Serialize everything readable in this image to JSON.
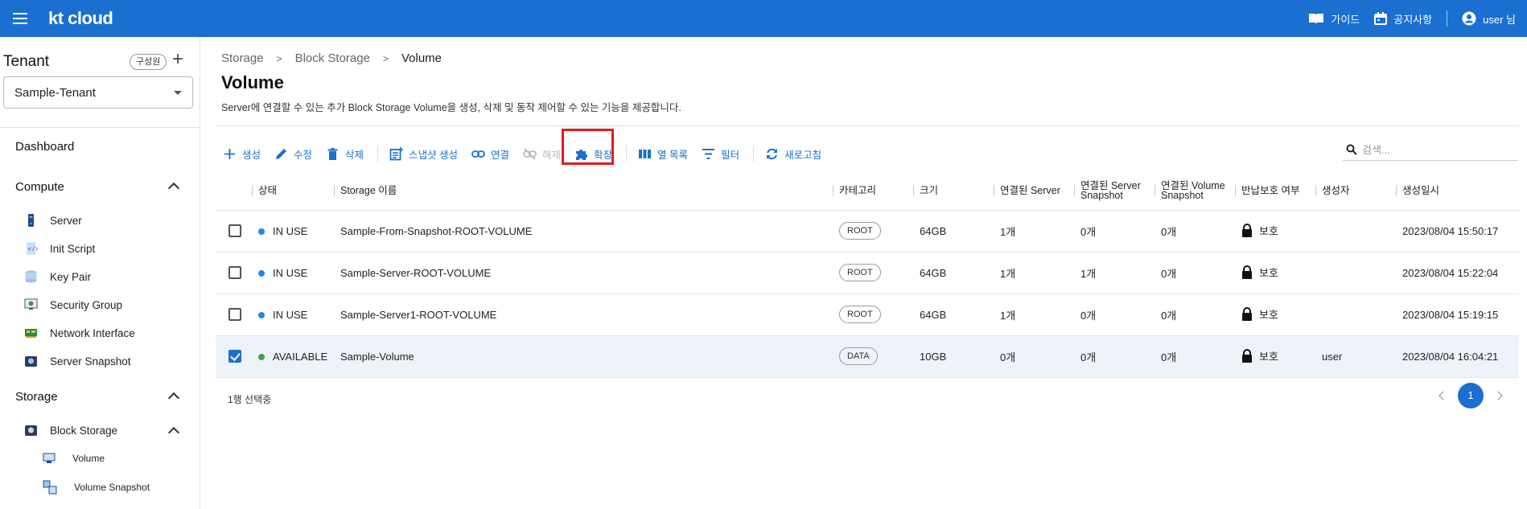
{
  "app": {
    "logo": "kt cloud"
  },
  "topbar": {
    "guide": "가이드",
    "notice": "공지사항",
    "user": "user 님"
  },
  "sidebar": {
    "tenant_title": "Tenant",
    "members_btn": "구성원",
    "add_btn": "+",
    "tenant_value": "Sample-Tenant",
    "dashboard": "Dashboard",
    "compute": {
      "label": "Compute",
      "items": [
        "Server",
        "Init Script",
        "Key Pair",
        "Security Group",
        "Network Interface",
        "Server Snapshot"
      ]
    },
    "storage": {
      "label": "Storage",
      "block_storage": "Block Storage",
      "sub_items": [
        "Volume",
        "Volume Snapshot"
      ]
    }
  },
  "breadcrumb": [
    "Storage",
    "Block Storage",
    "Volume"
  ],
  "page": {
    "title": "Volume",
    "description": "Server에 연결할 수 있는 추가 Block Storage Volume을 생성, 삭제 및 동작 제어할 수 있는 기능을 제공합니다."
  },
  "toolbar": {
    "create": "생성",
    "edit": "수정",
    "delete": "삭제",
    "snapshot": "스냅샷 생성",
    "attach": "연결",
    "detach": "해제",
    "extend": "확장",
    "columns": "열 목록",
    "filter": "필터",
    "refresh": "새로고침",
    "search_placeholder": "검색..."
  },
  "table": {
    "headers": [
      "상태",
      "Storage 이름",
      "카테고리",
      "크기",
      "연결된 Server",
      "연결된 Server Snapshot",
      "연결된 Volume Snapshot",
      "반납보호 여부",
      "생성자",
      "생성일시"
    ],
    "rows": [
      {
        "checked": false,
        "status": "IN USE",
        "status_color": "#1e88e5",
        "name": "Sample-From-Snapshot-ROOT-VOLUME",
        "category": "ROOT",
        "size": "64GB",
        "server": "1개",
        "server_snap": "0개",
        "vol_snap": "0개",
        "protect": "보호",
        "creator": "",
        "created": "2023/08/04 15:50:17"
      },
      {
        "checked": false,
        "status": "IN USE",
        "status_color": "#1e88e5",
        "name": "Sample-Server-ROOT-VOLUME",
        "category": "ROOT",
        "size": "64GB",
        "server": "1개",
        "server_snap": "1개",
        "vol_snap": "0개",
        "protect": "보호",
        "creator": "",
        "created": "2023/08/04 15:22:04"
      },
      {
        "checked": false,
        "status": "IN USE",
        "status_color": "#1e88e5",
        "name": "Sample-Server1-ROOT-VOLUME",
        "category": "ROOT",
        "size": "64GB",
        "server": "1개",
        "server_snap": "0개",
        "vol_snap": "0개",
        "protect": "보호",
        "creator": "",
        "created": "2023/08/04 15:19:15"
      },
      {
        "checked": true,
        "status": "AVAILABLE",
        "status_color": "#43a047",
        "name": "Sample-Volume",
        "category": "DATA",
        "size": "10GB",
        "server": "0개",
        "server_snap": "0개",
        "vol_snap": "0개",
        "protect": "보호",
        "creator": "user",
        "created": "2023/08/04 16:04:21"
      }
    ]
  },
  "footer": {
    "selected": "1행 선택중",
    "page": "1"
  },
  "colors": {
    "brand": "#1a6fd0",
    "highlight": "#e41b1b",
    "in_use": "#1e88e5",
    "available": "#43a047"
  }
}
